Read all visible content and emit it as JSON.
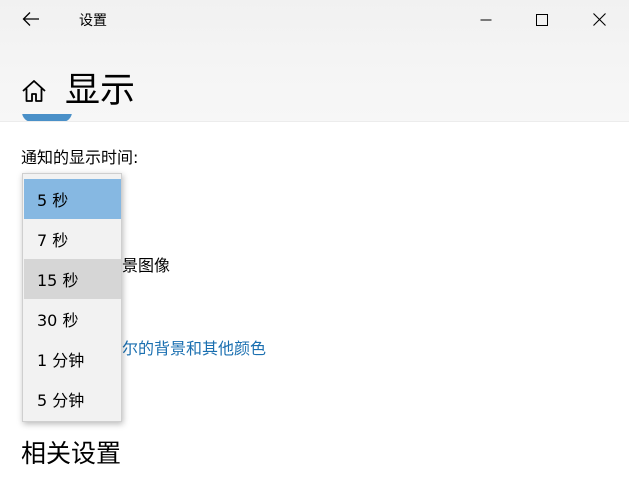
{
  "titlebar": {
    "app_title": "设置",
    "back_icon": "arrow-left-icon",
    "minimize_icon": "minimize-icon",
    "maximize_icon": "maximize-icon",
    "close_icon": "close-icon"
  },
  "header": {
    "home_icon": "home-icon",
    "page_title": "显示"
  },
  "content": {
    "notification_time_label": "通知的显示时间:",
    "partial_text": "景图像",
    "partial_link": "尔的背景和其他颜色",
    "related_settings_title": "相关设置"
  },
  "dropdown": {
    "options": [
      {
        "label": "5 秒",
        "state": "selected"
      },
      {
        "label": "7 秒",
        "state": "normal"
      },
      {
        "label": "15 秒",
        "state": "hover"
      },
      {
        "label": "30 秒",
        "state": "normal"
      },
      {
        "label": "1 分钟",
        "state": "normal"
      },
      {
        "label": "5 分钟",
        "state": "normal"
      }
    ]
  },
  "colors": {
    "accent": "#0078d7",
    "link": "#1a6fb0",
    "selected_item": "#86b8e2",
    "hover_item": "#d6d6d6",
    "dropdown_bg": "#f2f2f2"
  }
}
